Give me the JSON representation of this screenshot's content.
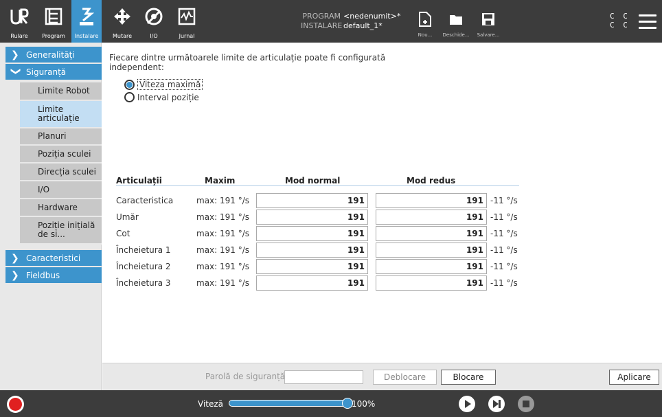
{
  "topbar": {
    "tabs": [
      {
        "label": "Rulare",
        "icon": "ur-logo-icon"
      },
      {
        "label": "Program",
        "icon": "program-icon"
      },
      {
        "label": "Instalare",
        "icon": "installation-icon",
        "active": true
      },
      {
        "label": "Mutare",
        "icon": "move-icon"
      },
      {
        "label": "I/O",
        "icon": "io-icon"
      },
      {
        "label": "Jurnal",
        "icon": "log-icon"
      }
    ],
    "program_label": "PROGRAM",
    "program_value": "<nedenumit>*",
    "install_label": "INSTALARE",
    "install_value": "default_1*",
    "file_buttons": [
      {
        "label": "Nou...",
        "icon": "new-file-icon"
      },
      {
        "label": "Deschide...",
        "icon": "folder-icon"
      },
      {
        "label": "Salvare...",
        "icon": "save-icon"
      }
    ],
    "cc_top": "C C",
    "cc_bottom": "C C"
  },
  "sidebar": {
    "groups": [
      {
        "label": "Generalități",
        "expanded": false
      },
      {
        "label": "Siguranță",
        "expanded": true
      },
      {
        "label": "Caracteristici",
        "expanded": false
      },
      {
        "label": "Fieldbus",
        "expanded": false
      }
    ],
    "items": [
      {
        "label": "Limite Robot"
      },
      {
        "label": "Limite articulație",
        "active": true
      },
      {
        "label": "Planuri"
      },
      {
        "label": "Poziția sculei"
      },
      {
        "label": "Direcția sculei"
      },
      {
        "label": "I/O"
      },
      {
        "label": "Hardware"
      },
      {
        "label": "Poziție inițială de si..."
      }
    ]
  },
  "main": {
    "description": "Fiecare dintre următoarele limite de articulație poate fi configurată independent:",
    "radio_options": [
      {
        "label": "Viteza maximă",
        "selected": true
      },
      {
        "label": "Interval poziție",
        "selected": false
      }
    ],
    "table": {
      "headers": [
        "Articulații",
        "Maxim",
        "Mod normal",
        "Mod redus"
      ],
      "rows": [
        {
          "name": "Caracteristica",
          "max": "max: 191 °/s",
          "normal": "191",
          "reduced": "191",
          "unit": "-11 °/s"
        },
        {
          "name": "Umăr",
          "max": "max: 191 °/s",
          "normal": "191",
          "reduced": "191",
          "unit": "-11 °/s"
        },
        {
          "name": "Cot",
          "max": "max: 191 °/s",
          "normal": "191",
          "reduced": "191",
          "unit": "-11 °/s"
        },
        {
          "name": "Încheietura 1",
          "max": "max: 191 °/s",
          "normal": "191",
          "reduced": "191",
          "unit": "-11 °/s"
        },
        {
          "name": "Încheietura 2",
          "max": "max: 191 °/s",
          "normal": "191",
          "reduced": "191",
          "unit": "-11 °/s"
        },
        {
          "name": "Încheietura 3",
          "max": "max: 191 °/s",
          "normal": "191",
          "reduced": "191",
          "unit": "-11 °/s"
        }
      ]
    }
  },
  "bottom": {
    "password_label": "Parolă de siguranță",
    "password_value": "",
    "unlock_label": "Deblocare",
    "lock_label": "Blocare",
    "apply_label": "Aplicare"
  },
  "footer": {
    "speed_label": "Viteză",
    "speed_value": "100%",
    "speed_fraction": 1.0
  },
  "colors": {
    "accent": "#3d94cc",
    "bar": "#3c3c3c",
    "record": "#e02020"
  }
}
